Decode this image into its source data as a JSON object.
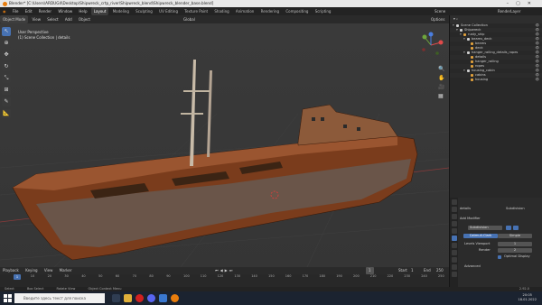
{
  "window": {
    "title": "Blender* [C:\\Users\\ARDUG4\\Desktop\\Shipwreck_crtp_river\\Shipwreck_blend\\Shipwreck_blender_base.blend]"
  },
  "menu": [
    "File",
    "Edit",
    "Render",
    "Window",
    "Help"
  ],
  "workspaces": [
    "Layout",
    "Modeling",
    "Sculpting",
    "UV Editing",
    "Texture Paint",
    "Shading",
    "Animation",
    "Rendering",
    "Compositing",
    "Scripting"
  ],
  "scene": {
    "scene_name": "Scene",
    "view_layer": "RenderLayer"
  },
  "viewport": {
    "mode": "Object Mode",
    "menu": [
      "View",
      "Select",
      "Add",
      "Object"
    ],
    "transform": "Global",
    "options": "Options",
    "info_line1": "User Perspective",
    "info_line2": "(1) Scene Collection | details"
  },
  "outliner": {
    "rows": [
      {
        "label": "Scene Collection",
        "depth": 0
      },
      {
        "label": "Shipwreck",
        "depth": 1
      },
      {
        "label": "rusty_ship",
        "depth": 2
      },
      {
        "label": "beams_deck",
        "depth": 3
      },
      {
        "label": "beams",
        "depth": 4
      },
      {
        "label": "deck",
        "depth": 4
      },
      {
        "label": "hanger_railing_details_ropes",
        "depth": 3
      },
      {
        "label": "details",
        "depth": 4
      },
      {
        "label": "hanger_railing",
        "depth": 4
      },
      {
        "label": "ropes",
        "depth": 4
      },
      {
        "label": "housing_cabin",
        "depth": 3
      },
      {
        "label": "cabins",
        "depth": 4
      },
      {
        "label": "housing",
        "depth": 4
      }
    ]
  },
  "properties": {
    "object_name": "details",
    "modifier_name_right": "Subdivision",
    "add_modifier": "Add Modifier",
    "modifier": "Subdivision",
    "algo_active": "Catmull-Clark",
    "algo_other": "Simple",
    "levels_viewport_label": "Levels Viewport",
    "levels_viewport_value": "1",
    "render_label": "Render",
    "render_value": "2",
    "optimal_display": "Optimal Display",
    "advanced": "Advanced"
  },
  "timeline": {
    "menu": [
      "Playback",
      "Keying",
      "View",
      "Marker"
    ],
    "current_frame": "1",
    "start_label": "Start",
    "start_value": "1",
    "end_label": "End",
    "end_value": "250",
    "ticks": [
      "0",
      "10",
      "20",
      "30",
      "40",
      "50",
      "60",
      "70",
      "80",
      "90",
      "100",
      "110",
      "120",
      "130",
      "140",
      "150",
      "160",
      "170",
      "180",
      "190",
      "200",
      "210",
      "220",
      "230",
      "240",
      "250"
    ]
  },
  "statusbar": [
    "Select",
    "Box Select",
    "Rotate View",
    "Object Context Menu"
  ],
  "version": "2.92.0",
  "taskbar": {
    "search_placeholder": "Введите здесь текст для поиска",
    "time": "20:05",
    "date": "18.01.2022"
  }
}
